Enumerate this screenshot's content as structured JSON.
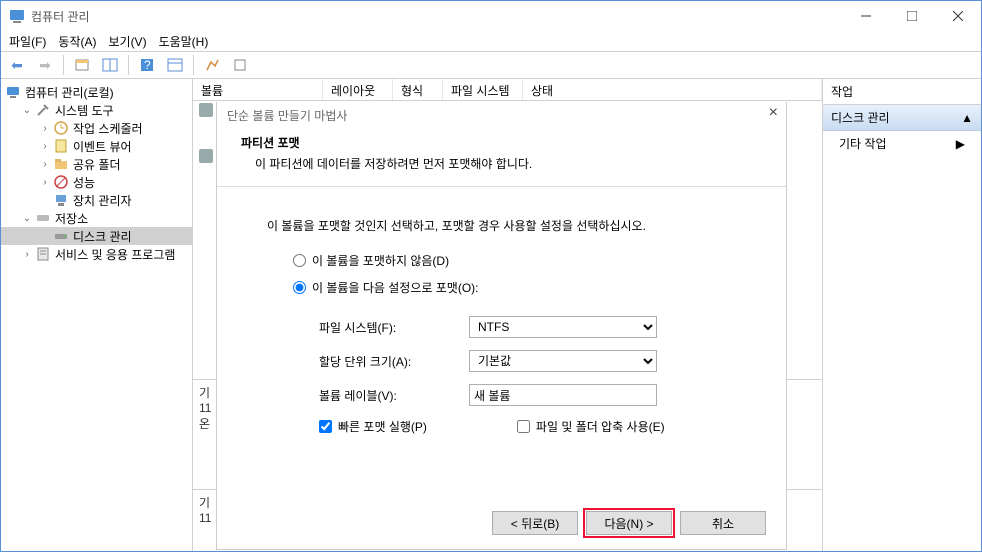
{
  "window": {
    "title": "컴퓨터 관리"
  },
  "menu": {
    "file": "파일(F)",
    "action": "동작(A)",
    "view": "보기(V)",
    "help": "도움말(H)"
  },
  "tree": {
    "root": "컴퓨터 관리(로컬)",
    "systemTools": "시스템 도구",
    "scheduler": "작업 스케줄러",
    "eventViewer": "이벤트 뷰어",
    "sharedFolders": "공유 폴더",
    "performance": "성능",
    "deviceManager": "장치 관리자",
    "storage": "저장소",
    "diskMgmt": "디스크 관리",
    "services": "서비스 및 응용 프로그램"
  },
  "columns": {
    "volume": "볼륨",
    "layout": "레이아웃",
    "type": "형식",
    "fs": "파일 시스템",
    "status": "상태"
  },
  "disk": {
    "label1": "기",
    "label2": "11",
    "label3": "온"
  },
  "actions": {
    "header": "작업",
    "section": "디스크 관리",
    "more": "기타 작업"
  },
  "wizard": {
    "title": "단순 볼륨 만들기 마법사",
    "heading": "파티션 포맷",
    "subheading": "이 파티션에 데이터를 저장하려면 먼저 포맷해야 합니다.",
    "instruction": "이 볼륨을 포맷할 것인지 선택하고, 포맷할 경우 사용할 설정을 선택하십시오.",
    "radioNoFormat": "이 볼륨을 포맷하지 않음(D)",
    "radioFormat": "이 볼륨을 다음 설정으로 포맷(O):",
    "fsLabel": "파일 시스템(F):",
    "fsValue": "NTFS",
    "allocLabel": "할당 단위 크기(A):",
    "allocValue": "기본값",
    "volLabel": "볼륨 레이블(V):",
    "volValue": "새 볼륨",
    "quickFormat": "빠른 포맷 실행(P)",
    "compress": "파일 및 폴더 압축 사용(E)",
    "back": "< 뒤로(B)",
    "next": "다음(N) >",
    "cancel": "취소"
  }
}
